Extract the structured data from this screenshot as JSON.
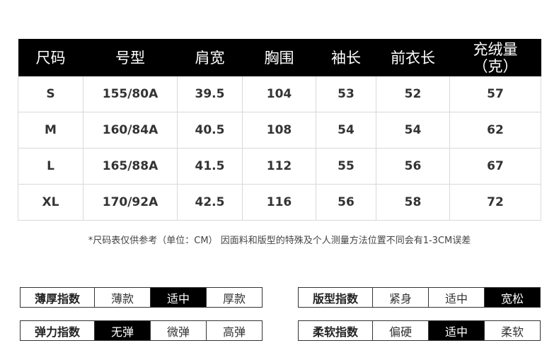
{
  "table": {
    "headers": [
      "尺码",
      "号型",
      "肩宽",
      "胸围",
      "袖长",
      "前衣长",
      "充绒量\n（克）"
    ],
    "rows": [
      [
        "S",
        "155/80A",
        "39.5",
        "104",
        "53",
        "52",
        "57"
      ],
      [
        "M",
        "160/84A",
        "40.5",
        "108",
        "54",
        "54",
        "62"
      ],
      [
        "L",
        "165/88A",
        "41.5",
        "112",
        "55",
        "56",
        "67"
      ],
      [
        "XL",
        "170/92A",
        "42.5",
        "116",
        "56",
        "58",
        "72"
      ]
    ]
  },
  "note": "*尺码表仅供参考（单位：CM） 因面料和版型的特殊及个人测量方法位置不同会有1-3CM误差",
  "scales": {
    "thickness": {
      "label": "薄厚指数",
      "options": [
        "薄款",
        "适中",
        "厚款"
      ],
      "selected": 1
    },
    "cut": {
      "label": "版型指数",
      "options": [
        "紧身",
        "适中",
        "宽松"
      ],
      "selected": 2
    },
    "elastic": {
      "label": "弹力指数",
      "options": [
        "无弹",
        "微弹",
        "高弹"
      ],
      "selected": 0
    },
    "soft": {
      "label": "柔软指数",
      "options": [
        "偏硬",
        "适中",
        "柔软"
      ],
      "selected": 1
    }
  }
}
